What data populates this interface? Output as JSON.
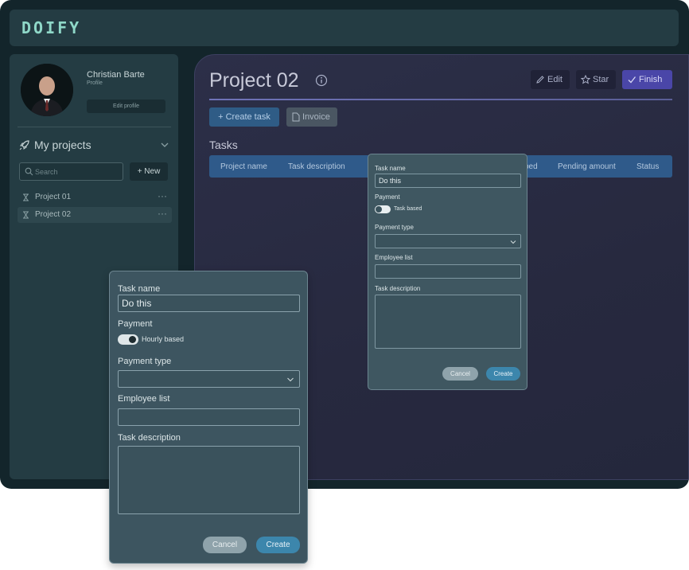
{
  "app": {
    "logo": "DOIFY"
  },
  "sidebar": {
    "user_name": "Christian Barte",
    "user_sub": "Profile",
    "edit_profile_label": "Edit profile",
    "projects_header": "My projects",
    "search_placeholder": "Search",
    "new_label": "+ New",
    "items": [
      {
        "label": "Project 01",
        "active": false,
        "more": "···"
      },
      {
        "label": "Project 02",
        "active": true,
        "more": "···"
      }
    ]
  },
  "main": {
    "title": "Project 02",
    "edit_label": "Edit",
    "star_label": "Star",
    "finish_label": "Finish",
    "create_task_label": "+ Create task",
    "invoice_label": "Invoice",
    "tasks_heading": "Tasks",
    "columns": [
      "Project name",
      "Task description",
      "bed",
      "Pending amount",
      "Status"
    ]
  },
  "modal_small": {
    "task_name_label": "Task name",
    "task_name_value": "Do this",
    "payment_label": "Payment",
    "payment_toggle_label": "Task based",
    "payment_toggle_on": false,
    "payment_type_label": "Payment type",
    "payment_type_value": "",
    "employee_list_label": "Employee list",
    "employee_list_value": "",
    "task_description_label": "Task description",
    "cancel_label": "Cancel",
    "create_label": "Create"
  },
  "modal_big": {
    "task_name_label": "Task name",
    "task_name_value": "Do this",
    "payment_label": "Payment",
    "payment_toggle_label": "Hourly based",
    "payment_toggle_on": true,
    "payment_type_label": "Payment type",
    "payment_type_value": "",
    "employee_list_label": "Employee list",
    "employee_list_value": "",
    "task_description_label": "Task description",
    "cancel_label": "Cancel",
    "create_label": "Create"
  },
  "colors": {
    "accent_blue": "#2f5a8a",
    "finish_purple": "#4a46a8",
    "logo_teal": "#8fd8c8"
  }
}
